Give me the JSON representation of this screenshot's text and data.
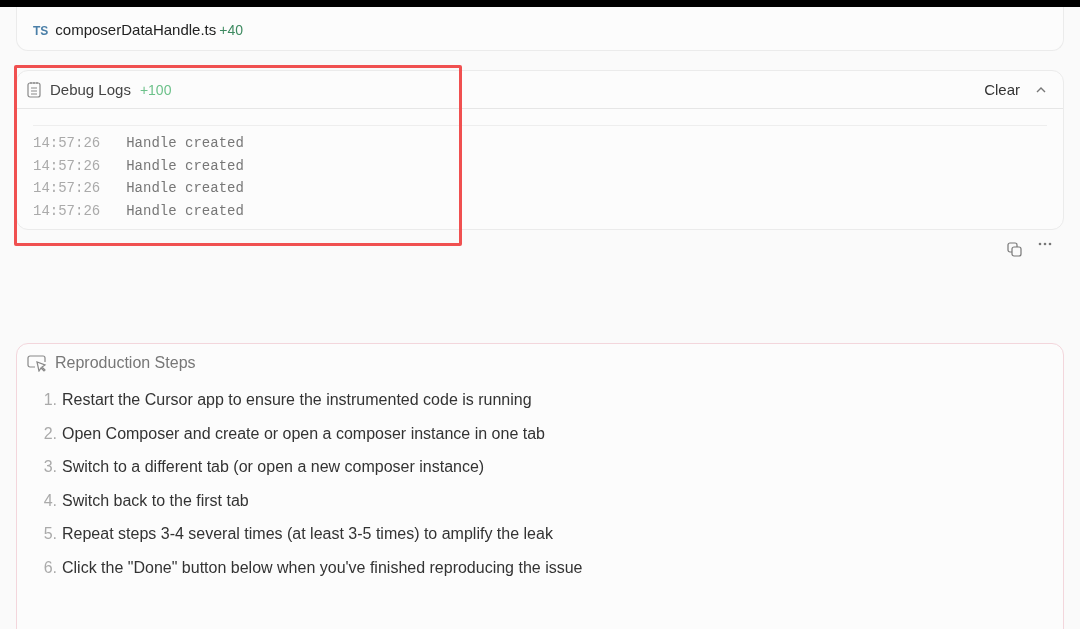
{
  "file_card": {
    "badge": "TS",
    "filename": "composerDataHandle.ts",
    "added": "+40"
  },
  "debug_logs": {
    "title": "Debug Logs",
    "count": "+100",
    "clear": "Clear",
    "expanded": true,
    "highlighted": true,
    "entries": [
      {
        "time": "14:57:26",
        "message": "Handle created"
      },
      {
        "time": "14:57:26",
        "message": "Handle created"
      },
      {
        "time": "14:57:26",
        "message": "Handle created"
      },
      {
        "time": "14:57:26",
        "message": "Handle created"
      }
    ]
  },
  "reproduction": {
    "title": "Reproduction Steps",
    "steps": [
      {
        "number": "1.",
        "text": "Restart the Cursor app to ensure the instrumented code is running"
      },
      {
        "number": "2.",
        "text": "Open Composer and create or open a composer instance in one tab"
      },
      {
        "number": "3.",
        "text": "Switch to a different tab (or open a new composer instance)"
      },
      {
        "number": "4.",
        "text": "Switch back to the first tab"
      },
      {
        "number": "5.",
        "text": "Repeat steps 3-4 several times (at least 3-5 times) to amplify the leak"
      },
      {
        "number": "6.",
        "text": "Click the \"Done\" button below when you've finished reproducing the issue"
      }
    ]
  }
}
